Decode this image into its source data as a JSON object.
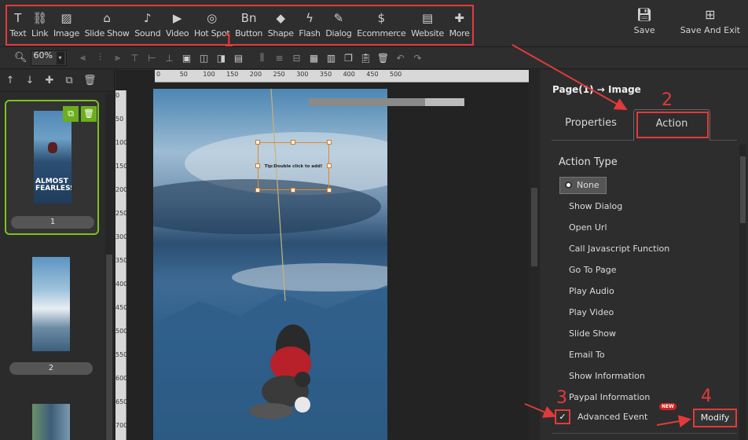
{
  "toolbar": {
    "tools": [
      {
        "label": "Text",
        "icon": "text-icon",
        "glyph": "T"
      },
      {
        "label": "Link",
        "icon": "link-icon",
        "glyph": "⛓"
      },
      {
        "label": "Image",
        "icon": "image-icon",
        "glyph": "▨"
      },
      {
        "label": "Slide Show",
        "icon": "slideshow-icon",
        "glyph": "⌂"
      },
      {
        "label": "Sound",
        "icon": "sound-icon",
        "glyph": "♪"
      },
      {
        "label": "Video",
        "icon": "video-icon",
        "glyph": "▶"
      },
      {
        "label": "Hot Spot",
        "icon": "hotspot-icon",
        "glyph": "◎"
      },
      {
        "label": "Button",
        "icon": "button-icon",
        "glyph": "Bn"
      },
      {
        "label": "Shape",
        "icon": "shape-icon",
        "glyph": "◆"
      },
      {
        "label": "Flash",
        "icon": "flash-icon",
        "glyph": "ϟ"
      },
      {
        "label": "Dialog",
        "icon": "dialog-icon",
        "glyph": "✎"
      },
      {
        "label": "Ecommerce",
        "icon": "dollar-icon",
        "glyph": "$"
      },
      {
        "label": "Website",
        "icon": "website-icon",
        "glyph": "▤"
      },
      {
        "label": "More",
        "icon": "puzzle-icon",
        "glyph": "✚"
      }
    ],
    "save_label": "Save",
    "save_exit_label": "Save And Exit",
    "marker_1": "1"
  },
  "zoom": {
    "value": "60%"
  },
  "pages": [
    {
      "number": "1",
      "selected": true
    },
    {
      "number": "2",
      "selected": false
    }
  ],
  "canvas": {
    "tip_text": "Tip:Double click to add!",
    "ruler_h": [
      "0",
      "50",
      "100",
      "150",
      "200",
      "250",
      "300",
      "350",
      "400",
      "450",
      "500"
    ],
    "ruler_v": [
      "0",
      "50",
      "100",
      "150",
      "200",
      "250",
      "300",
      "350",
      "400",
      "450",
      "500",
      "550",
      "600",
      "650",
      "700"
    ]
  },
  "thumb_text": {
    "line1": "ALMOST",
    "line2": "FEARLESS"
  },
  "panel": {
    "title": "Page(1) → Image",
    "marker_2": "2",
    "tabs": {
      "properties": "Properties",
      "action": "Action"
    },
    "action_type_label": "Action Type",
    "options": [
      "None",
      "Show Dialog",
      "Open Url",
      "Call Javascript Function",
      "Go To Page",
      "Play Audio",
      "Play Video",
      "Slide Show",
      "Email To",
      "Show Information",
      "Paypal Information"
    ],
    "selected_option": "None",
    "advanced_event_label": "Advanced Event",
    "advanced_event_checked": true,
    "new_badge": "NEW",
    "modify_label": "Modify",
    "marker_3": "3",
    "marker_4": "4"
  },
  "colors": {
    "highlight": "#e23a3a",
    "selected_page": "#7cc21f"
  }
}
